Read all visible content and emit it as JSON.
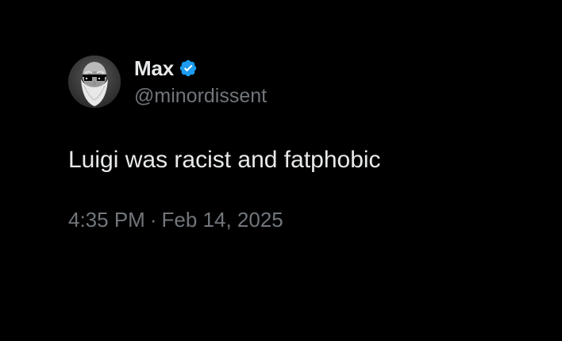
{
  "tweet": {
    "display_name": "Max",
    "handle": "@minordissent",
    "text": "Luigi was racist and fatphobic",
    "time": "4:35 PM",
    "separator": "·",
    "date": "Feb 14, 2025",
    "verified": true,
    "avatar_icon": "avatar-bearded-man-sunglasses",
    "verified_icon": "verified-badge-icon"
  },
  "colors": {
    "background": "#000000",
    "primary_text": "#e7e9ea",
    "secondary_text": "#71767b",
    "verified_blue": "#1d9bf0"
  }
}
